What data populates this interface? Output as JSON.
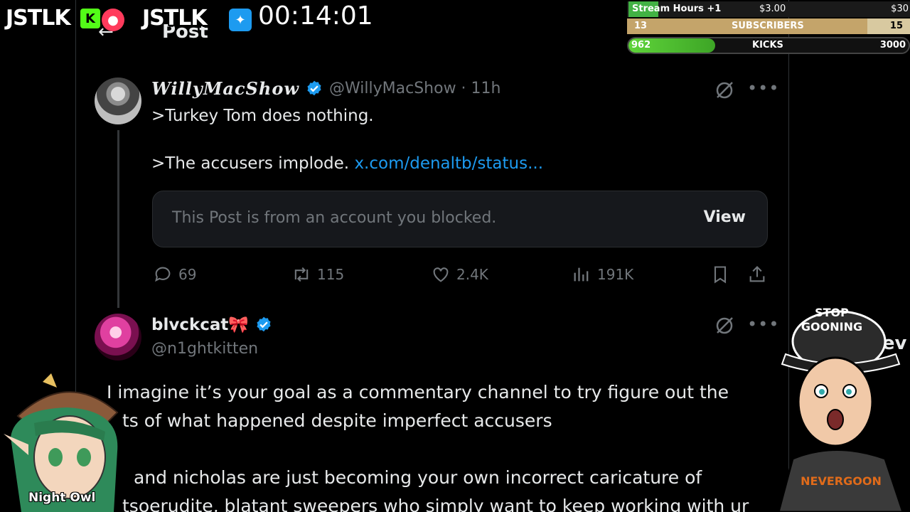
{
  "stream": {
    "logo1": "JSTLK",
    "logo2": "JSTLK",
    "timer": "00:14:01",
    "stats": {
      "stream_hours_label": "Stream Hours +1",
      "stream_hours_mid": "$3.00",
      "stream_hours_right": "$30",
      "subs_count": "13",
      "subs_label": "SUBSCRIBERS",
      "subs_goal": "15",
      "kicks_count": "962",
      "kicks_label": "KICKS",
      "kicks_goal": "3000"
    },
    "sticker_hat_text": "STOP GOONING",
    "owl_label": "Night Owl"
  },
  "page": {
    "header_title": "Post"
  },
  "tweet1": {
    "name": "WillyMacShow",
    "handle": "@WillyMacShow · 11h",
    "line1": ">Turkey Tom does nothing.",
    "line2_prefix": ">The accusers implode. ",
    "line2_link": "x.com/denaltb/status...",
    "blocked_text": "This Post is from an account you blocked.",
    "blocked_view": "View",
    "replies": "69",
    "reposts": "115",
    "likes": "2.4K",
    "views": "191K"
  },
  "tweet2": {
    "name": "blvckcat🎀",
    "handle": "@n1ghtkitten",
    "line1": "I imagine it’s your goal as a commentary channel to try figure out the",
    "line2": "ts of what happened despite imperfect accusers",
    "line3": "and nicholas are just becoming your own incorrect caricature of",
    "line4": "tsoerudite, blatant sweepers who simply want to keep working with ur"
  },
  "right_partial": "lev",
  "colors": {
    "accent": "#1d9bf0",
    "muted": "#71767b",
    "text": "#e7e9ea",
    "background": "#000000"
  }
}
